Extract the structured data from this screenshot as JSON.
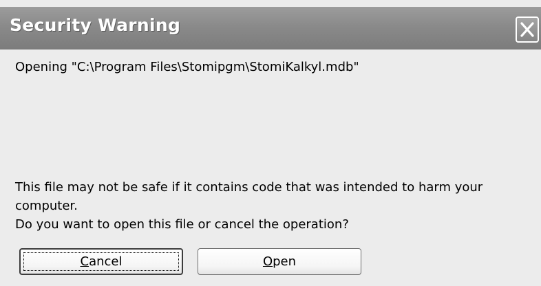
{
  "dialog": {
    "title": "Security Warning",
    "close_icon": "close-icon"
  },
  "message": {
    "opening_line": "Opening \"C:\\Program Files\\Stomipgm\\StomiKalkyl.mdb\"",
    "warning_line_1": "This file may not be safe if it contains code that was intended to harm your",
    "warning_line_2": "computer.",
    "question_line": "Do you want to open this file or cancel the operation?"
  },
  "buttons": {
    "cancel": {
      "accel": "C",
      "rest": "ancel"
    },
    "open": {
      "accel": "O",
      "rest": "pen"
    }
  }
}
